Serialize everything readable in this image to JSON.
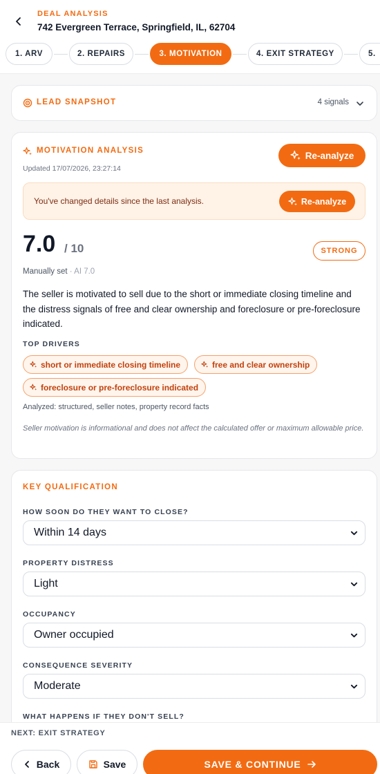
{
  "header": {
    "eyebrow": "DEAL ANALYSIS",
    "address": "742 Evergreen Terrace, Springfield, IL, 62704"
  },
  "steps": [
    {
      "label": "1.  ARV",
      "active": false
    },
    {
      "label": "2.  REPAIRS",
      "active": false
    },
    {
      "label": "3.  MOTIVATION",
      "active": true
    },
    {
      "label": "4.  EXIT STRATEGY",
      "active": false
    },
    {
      "label": "5.",
      "active": false
    }
  ],
  "lead_snapshot": {
    "title": "LEAD SNAPSHOT",
    "signals": "4 signals"
  },
  "motivation": {
    "title": "MOTIVATION ANALYSIS",
    "updated": "Updated 17/07/2026, 23:27:14",
    "reanalyze_label": "Re-analyze",
    "notice_text": "You've changed details since the last analysis.",
    "notice_button": "Re-analyze",
    "score": "7.0",
    "score_max": "/ 10",
    "strength": "STRONG",
    "manual_set": "Manually set",
    "ai_score": "· AI 7.0",
    "summary": "The seller is motivated to sell due to the short or immediate closing timeline and the distress signals of free and clear ownership and foreclosure or pre-foreclosure indicated.",
    "drivers_label": "TOP DRIVERS",
    "drivers": [
      "short or immediate closing timeline",
      "free and clear ownership",
      "foreclosure or pre-foreclosure indicated"
    ],
    "analyzed": "Analyzed: structured, seller notes, property record facts",
    "disclaimer": "Seller motivation is informational and does not affect the calculated offer or maximum allowable price."
  },
  "qualification": {
    "title": "KEY QUALIFICATION",
    "fields": [
      {
        "label": "HOW SOON DO THEY WANT TO CLOSE?",
        "value": "Within 14 days"
      },
      {
        "label": "PROPERTY DISTRESS",
        "value": "Light"
      },
      {
        "label": "OCCUPANCY",
        "value": "Owner occupied"
      },
      {
        "label": "CONSEQUENCE SEVERITY",
        "value": "Moderate"
      },
      {
        "label": "WHAT HAPPENS IF THEY DON'T SELL?",
        "value": ""
      }
    ]
  },
  "footer": {
    "next_label": "NEXT: EXIT STRATEGY",
    "back_label": "Back",
    "save_label": "Save",
    "continue_label": "SAVE & CONTINUE"
  },
  "colors": {
    "accent": "#f26b12",
    "notice_bg": "#fff3e8"
  }
}
